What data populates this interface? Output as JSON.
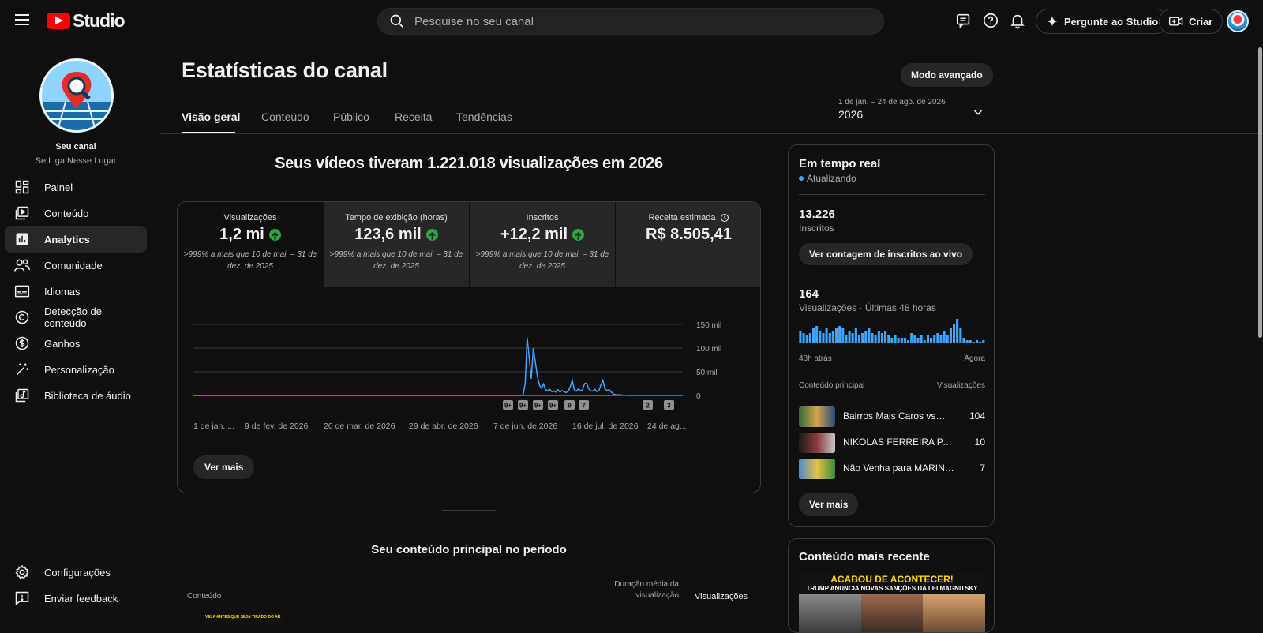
{
  "app": {
    "logo_text": "Studio"
  },
  "search": {
    "placeholder": "Pesquise no seu canal"
  },
  "topbar": {
    "ask_studio": "Pergunte ao Studio",
    "create": "Criar"
  },
  "channel": {
    "title": "Seu canal",
    "name": "Se Liga Nesse Lugar"
  },
  "nav": {
    "items": [
      {
        "label": "Painel",
        "icon": "dashboard-icon"
      },
      {
        "label": "Conteúdo",
        "icon": "content-icon"
      },
      {
        "label": "Analytics",
        "icon": "analytics-icon",
        "active": true
      },
      {
        "label": "Comunidade",
        "icon": "community-icon"
      },
      {
        "label": "Idiomas",
        "icon": "subtitles-icon"
      },
      {
        "label": "Detecção de conteúdo",
        "icon": "copyright-icon"
      },
      {
        "label": "Ganhos",
        "icon": "earn-icon"
      },
      {
        "label": "Personalização",
        "icon": "magic-wand-icon"
      },
      {
        "label": "Biblioteca de áudio",
        "icon": "audio-library-icon"
      }
    ],
    "bottom": [
      {
        "label": "Configurações",
        "icon": "gear-icon"
      },
      {
        "label": "Enviar feedback",
        "icon": "feedback-icon"
      }
    ]
  },
  "page": {
    "title": "Estatísticas do canal",
    "advanced_mode": "Modo avançado",
    "tabs": [
      "Visão geral",
      "Conteúdo",
      "Público",
      "Receita",
      "Tendências"
    ],
    "date_range": "1 de jan. – 24 de ago. de 2026",
    "date_value": "2026",
    "headline": "Seus vídeos tiveram 1.221.018 visualizações em 2026"
  },
  "metrics": [
    {
      "label": "Visualizações",
      "value": "1,2 mi",
      "up": true,
      "comparison": ">999% a mais que 10 de mai. – 31 de dez. de 2025"
    },
    {
      "label": "Tempo de exibição (horas)",
      "value": "123,6 mil",
      "up": true,
      "comparison": ">999% a mais que 10 de mai. – 31 de dez. de 2025"
    },
    {
      "label": "Inscritos",
      "value": "+12,2 mil",
      "up": true,
      "comparison": ">999% a mais que 10 de mai. – 31 de dez. de 2025"
    },
    {
      "label": "Receita estimada",
      "value": "R$ 8.505,41",
      "up": false,
      "comparison": ""
    }
  ],
  "chart_data": {
    "type": "line",
    "series": [
      {
        "values": [
          0,
          0,
          0,
          0,
          0,
          0,
          0,
          0,
          0,
          0,
          0,
          0,
          0,
          0,
          0,
          0,
          0,
          0,
          0,
          0,
          0,
          0,
          0,
          0,
          0,
          0,
          0,
          0,
          0,
          0,
          0,
          0,
          0,
          0,
          0,
          0,
          0,
          0,
          0,
          0,
          0,
          0,
          0,
          0,
          0,
          0,
          0,
          0,
          0,
          0,
          0,
          0,
          0,
          0,
          0,
          0,
          0,
          0,
          0,
          0,
          0,
          0,
          0,
          0,
          0,
          0,
          0,
          0,
          0,
          0,
          0,
          0,
          0,
          0,
          0,
          0,
          0,
          0,
          0,
          0,
          0,
          0,
          0,
          0,
          0,
          0,
          0,
          0,
          0,
          0,
          0,
          0,
          0,
          0,
          0,
          0,
          0,
          0,
          0,
          0,
          0,
          0,
          0,
          0,
          0,
          0,
          0,
          0,
          0,
          0,
          0,
          0,
          0,
          0,
          0,
          0,
          0,
          0,
          0,
          0,
          0,
          0,
          0,
          0,
          0,
          0,
          0,
          0,
          0,
          0,
          0,
          0,
          0,
          0,
          0,
          0,
          0,
          0,
          0,
          0,
          0,
          0,
          0,
          0,
          0,
          0,
          0,
          0,
          0,
          0,
          0,
          0,
          0,
          0,
          0,
          0,
          0,
          0,
          0,
          0,
          0,
          2000,
          25000,
          122000,
          80000,
          35000,
          100000,
          70000,
          40000,
          22000,
          15000,
          24000,
          12000,
          10000,
          13000,
          8000,
          9000,
          7000,
          12000,
          7000,
          10000,
          8000,
          6000,
          9000,
          18000,
          32000,
          12000,
          9000,
          14000,
          10000,
          12000,
          25000,
          26000,
          14000,
          10000,
          9000,
          13000,
          8000,
          10000,
          22000,
          32000,
          14000,
          10000,
          12000,
          8000,
          3000,
          2000,
          1000,
          1500,
          1000,
          500,
          300,
          200,
          200,
          100,
          100,
          100,
          100,
          100,
          100,
          100,
          100,
          100,
          100,
          100,
          100,
          100,
          100,
          100,
          100,
          100,
          100,
          100,
          100,
          100,
          100,
          100,
          100,
          100,
          100
        ]
      }
    ],
    "x_tick_labels": [
      "1 de jan. ...",
      "9 de fev. de 2026",
      "20 de mar. de 2026",
      "29 de abr. de 2026",
      "7 de jun. de 2026",
      "16 de jul. de 2026",
      "24 de ag..."
    ],
    "y_tick_labels": [
      "150 mil",
      "100 mil",
      "50 mil",
      "0"
    ],
    "ylim": [
      0,
      150000
    ],
    "grid": true,
    "markers": [
      "9+",
      "9+",
      "9+",
      "9+",
      "9",
      "7",
      "2",
      "3"
    ],
    "line_color": "#3ea6ff"
  },
  "overview": {
    "see_more": "Ver mais"
  },
  "top_content": {
    "title": "Seu conteúdo principal no período",
    "col_content": "Conteúdo",
    "col_avg_duration": "Duração média da visualização",
    "col_views": "Visualizações",
    "first_thumb_text": "VEJA ANTES QUE SEJA TIRADO DO AR"
  },
  "realtime": {
    "title": "Em tempo real",
    "status": "Atualizando",
    "subscribers_value": "13.226",
    "subscribers_label": "Inscritos",
    "live_count_button": "Ver contagem de inscritos ao vivo",
    "views_value": "164",
    "views_label": "Visualizações · Últimas 48 horas",
    "bars": [
      5,
      4,
      3,
      4,
      6,
      7,
      5,
      4,
      6,
      4,
      5,
      6,
      7,
      6,
      3,
      5,
      4,
      6,
      3,
      4,
      5,
      6,
      4,
      3,
      5,
      4,
      5,
      3,
      2,
      3,
      2,
      2,
      2,
      1,
      4,
      3,
      2,
      3,
      1,
      3,
      2,
      3,
      4,
      3,
      5,
      3,
      6,
      8,
      10,
      6,
      2,
      1,
      1,
      0,
      1,
      0,
      1
    ],
    "time_left": "48h atrás",
    "time_right": "Agora",
    "content_col": "Conteúdo principal",
    "views_col": "Visualizações",
    "rows": [
      {
        "title": "Bairros Mais Caros vs. ...",
        "views": "104"
      },
      {
        "title": "NIKOLAS FERREIRA PARA...",
        "views": "10"
      },
      {
        "title": "Não Venha para MARINGÁ ...",
        "views": "7"
      }
    ],
    "see_more": "Ver mais",
    "accent": "#3ea6ff"
  },
  "recent": {
    "title": "Conteúdo mais recente",
    "thumb_line1": "ACABOU DE ACONTECER!",
    "thumb_line2": "TRUMP ANUNCIA NOVAS SANÇÕES DA LEI MAGNITSKY"
  }
}
